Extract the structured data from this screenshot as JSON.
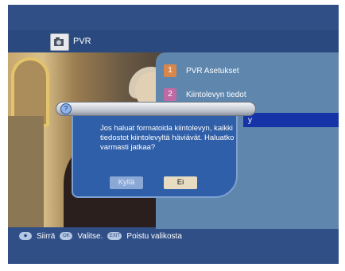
{
  "header": {
    "title": "PVR",
    "icon": "camera-icon"
  },
  "menu": {
    "items": [
      {
        "number": "1",
        "label": "PVR Asetukset",
        "color": "#d9864a"
      },
      {
        "number": "2",
        "label": "Kiintolevyn tiedot",
        "color": "#c06aa3"
      },
      {
        "number": "",
        "label": "y"
      }
    ]
  },
  "dialog": {
    "icon": "info-icon",
    "message": "Jos haluat formatoida kiintolevyn, kaikki tiedostot kiintolevyltä häviävät. Haluatko varmasti jatkaa?",
    "yes_label": "Kyllä",
    "no_label": "Ei"
  },
  "footer": {
    "move_label": "Siirrä",
    "ok_label": "Valitse.",
    "ok_badge": "OK",
    "exit_label": "Poistu valikosta",
    "exit_badge": "EXIT"
  }
}
